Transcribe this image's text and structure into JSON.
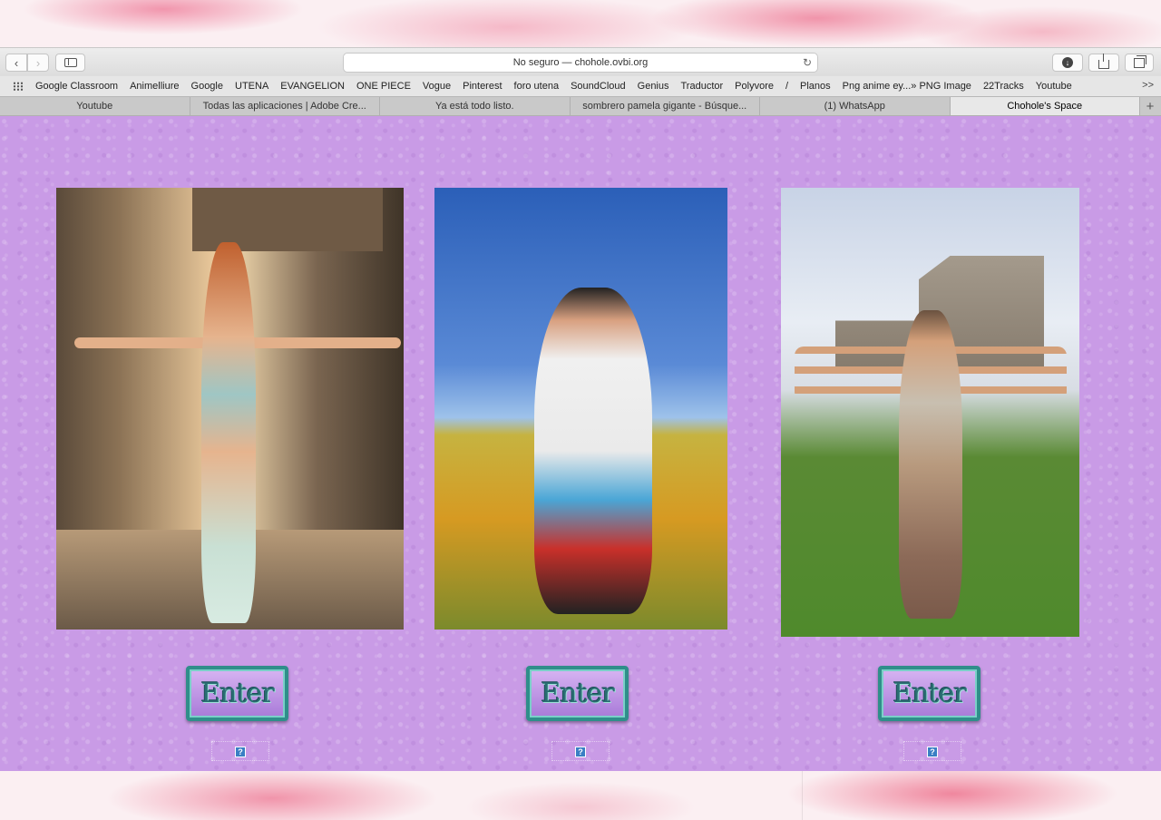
{
  "browser": {
    "address": "No seguro — chohole.ovbi.org",
    "bookmarks": [
      "Google Classroom",
      "Animelliure",
      "Google",
      "UTENA",
      "EVANGELION",
      "ONE PIECE",
      "Vogue",
      "Pinterest",
      "foro utena",
      "SoundCloud",
      "Genius",
      "Traductor",
      "Polyvore",
      "/",
      "Planos",
      "Png anime ey...» PNG Image",
      "22Tracks",
      "Youtube"
    ],
    "more": ">>",
    "tabs": [
      "Youtube",
      "Todas las aplicaciones | Adobe Cre...",
      "Ya está todo listo.",
      "sombrero pamela gigante - Búsque...",
      "(1) WhatsApp",
      "Chohole's Space"
    ],
    "active_tab_index": 5,
    "new_tab_symbol": "+"
  },
  "page": {
    "enter_buttons": [
      "Enter",
      "Enter",
      "Enter"
    ],
    "help_icon": "?",
    "background_color": "#c99be6"
  }
}
